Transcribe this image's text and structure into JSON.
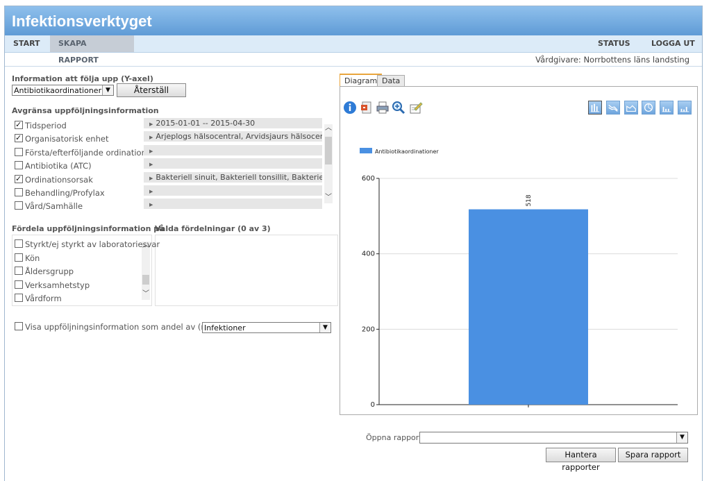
{
  "app": {
    "title": "Infektionsverktyget"
  },
  "nav": {
    "start": "START",
    "create_report": "SKAPA RAPPORT",
    "status": "STATUS",
    "logout": "LOGGA UT"
  },
  "provider": "Vårdgivare: Norrbottens läns landsting",
  "yaxis": {
    "label": "Information att följa upp (Y-axel)",
    "selected": "Antibiotikaordinationer",
    "reset_label": "Återställ"
  },
  "limit": {
    "label": "Avgränsa uppföljningsinformation",
    "items": [
      {
        "label": "Tidsperiod",
        "checked": true,
        "value": "2015-01-01 -- 2015-04-30"
      },
      {
        "label": "Organisatorisk enhet",
        "checked": true,
        "value": "Arjeplogs hälsocentral, Arvidsjaurs hälsocentral"
      },
      {
        "label": "Första/efterföljande ordination",
        "checked": false,
        "value": ""
      },
      {
        "label": "Antibiotika (ATC)",
        "checked": false,
        "value": ""
      },
      {
        "label": "Ordinationsorsak",
        "checked": true,
        "value": "Bakteriell sinuit, Bakteriell tonsillit, Bakteriell m"
      },
      {
        "label": "Behandling/Profylax",
        "checked": false,
        "value": ""
      },
      {
        "label": "Vård/Samhälle",
        "checked": false,
        "value": ""
      }
    ]
  },
  "distribute": {
    "label": "Fördela uppföljningsinformation på",
    "items": [
      "Styrkt/ej styrkt av laboratoriesvar",
      "Kön",
      "Åldersgrupp",
      "Verksamhetstyp",
      "Vårdform"
    ]
  },
  "selected_dist": {
    "label": "Valda fördelningar (0 av 3)"
  },
  "share": {
    "label": "Visa uppföljningsinformation som andel av (nämnare)",
    "selected": "Infektioner",
    "checked": false
  },
  "tabs": {
    "diagram": "Diagram",
    "data": "Data"
  },
  "toolbar_icons": [
    "info-icon",
    "export-icon",
    "print-icon",
    "zoom-icon",
    "edit-icon"
  ],
  "chart_type_icons": [
    "bar-chart-icon",
    "line-chart-icon",
    "area-chart-icon",
    "pie-chart-icon",
    "column-chart-icon",
    "stacked-chart-icon"
  ],
  "colors": {
    "header": "#5f9bd6",
    "bar": "#4a90e2"
  },
  "chart_data": {
    "type": "bar",
    "categories": [
      ""
    ],
    "series": [
      {
        "name": "Antibiotikaordinationer",
        "values": [
          518
        ]
      }
    ],
    "ylim": [
      0,
      600
    ],
    "yticks": [
      0,
      200,
      400,
      600
    ],
    "data_labels": [
      "518"
    ],
    "legend": "top-left",
    "grid": true
  },
  "footer": {
    "open_report_label": "Öppna rapport",
    "open_report_value": "",
    "manage_label": "Hantera rapporter",
    "save_label": "Spara rapport"
  }
}
